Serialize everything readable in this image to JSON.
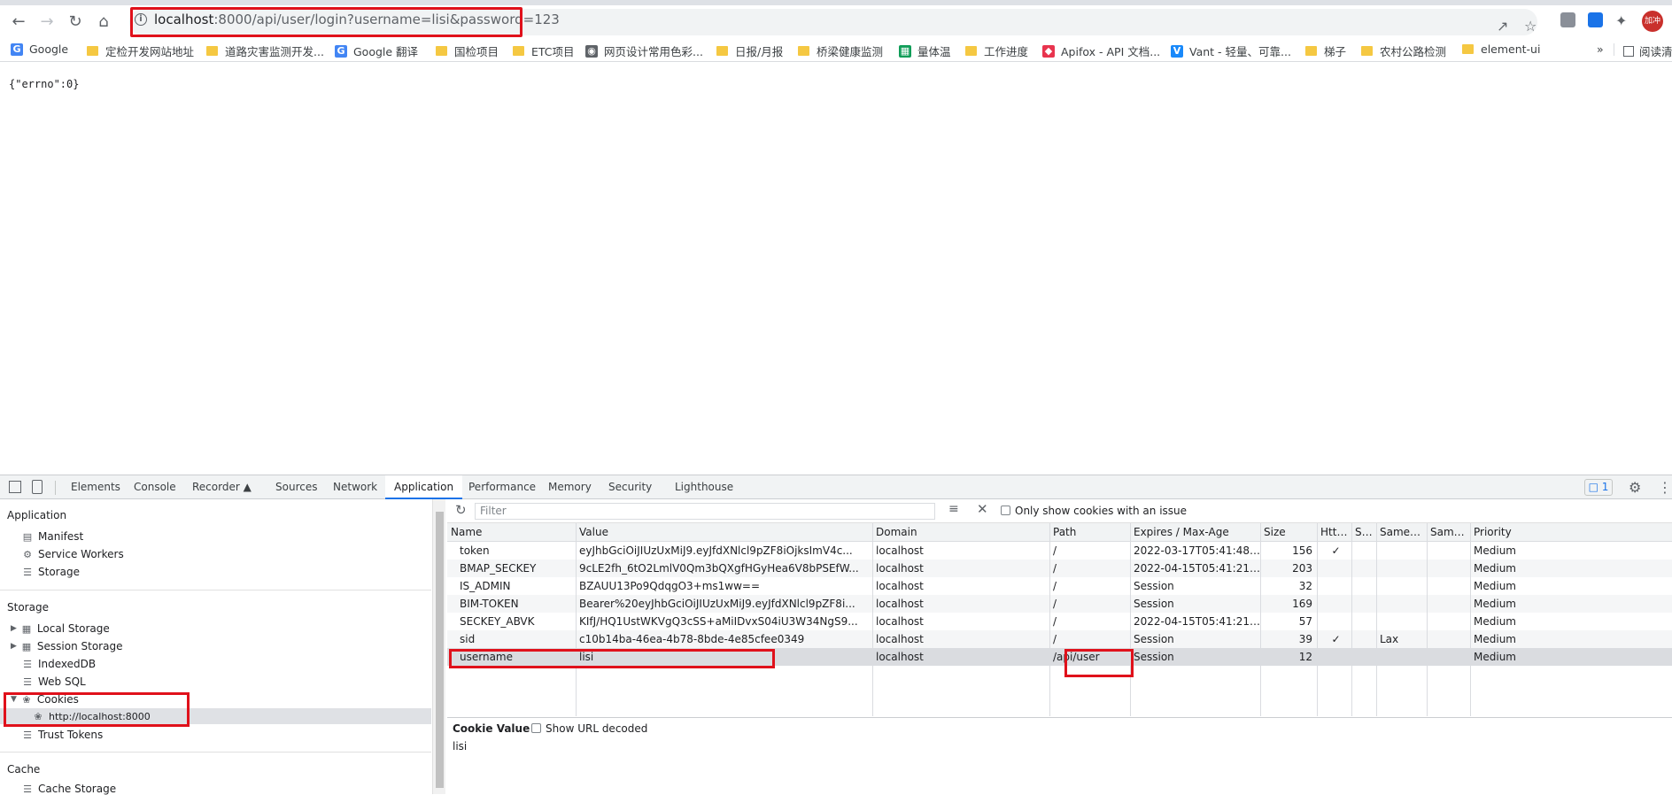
{
  "browser": {
    "url_host": "localhost",
    "url_rest": ":8000/api/user/login?username=lisi&password=123",
    "avatar_text": "加冲"
  },
  "bookmarks": [
    {
      "label": "Google",
      "type": "google"
    },
    {
      "label": "定检开发网站地址",
      "type": "folder"
    },
    {
      "label": "道路灾害监测开发...",
      "type": "folder"
    },
    {
      "label": "Google 翻译",
      "type": "translate"
    },
    {
      "label": "国检项目",
      "type": "folder"
    },
    {
      "label": "ETC项目",
      "type": "folder"
    },
    {
      "label": "网页设计常用色彩...",
      "type": "globe"
    },
    {
      "label": "日报/月报",
      "type": "folder"
    },
    {
      "label": "桥梁健康监测",
      "type": "folder"
    },
    {
      "label": "量体温",
      "type": "sheet"
    },
    {
      "label": "工作进度",
      "type": "folder"
    },
    {
      "label": "Apifox - API 文档...",
      "type": "apifox"
    },
    {
      "label": "Vant - 轻量、可靠...",
      "type": "vant"
    },
    {
      "label": "梯子",
      "type": "folder"
    },
    {
      "label": "农村公路检测",
      "type": "folder"
    },
    {
      "label": "element-ui",
      "type": "folder"
    }
  ],
  "bookmarks_more": "»",
  "reading_list": "阅读清",
  "page_body": "{\"errno\":0}",
  "devtools": {
    "tabs": [
      "Elements",
      "Console",
      "Recorder",
      "Sources",
      "Network",
      "Application",
      "Performance",
      "Memory",
      "Security",
      "Lighthouse"
    ],
    "active_tab": "Application",
    "issues_count": "1",
    "sidebar": {
      "application_header": "Application",
      "manifest": "Manifest",
      "service_workers": "Service Workers",
      "storage_item": "Storage",
      "storage_header": "Storage",
      "local_storage": "Local Storage",
      "session_storage": "Session Storage",
      "indexeddb": "IndexedDB",
      "web_sql": "Web SQL",
      "cookies": "Cookies",
      "cookie_origin": "http://localhost:8000",
      "trust_tokens": "Trust Tokens",
      "cache_header": "Cache",
      "cache_storage": "Cache Storage"
    },
    "cookies_toolbar": {
      "filter_placeholder": "Filter",
      "only_issue_label": "Only show cookies with an issue"
    },
    "columns": [
      "Name",
      "Value",
      "Domain",
      "Path",
      "Expires / Max-Age",
      "Size",
      "HttpO...",
      "Sec...",
      "SameSite",
      "SameParty",
      "Priority"
    ],
    "rows": [
      {
        "name": "token",
        "value": "eyJhbGciOiJIUzUxMiJ9.eyJfdXNlcl9pZF8iOjksImV4c...",
        "domain": "localhost",
        "path": "/",
        "expires": "2022-03-17T05:41:48.002Z",
        "size": "156",
        "httponly": "✓",
        "secure": "",
        "samesite": "",
        "sameparty": "",
        "priority": "Medium"
      },
      {
        "name": "BMAP_SECKEY",
        "value": "9cLE2fh_6tO2LmlV0Qm3bQXgfHGyHea6V8bPSEfW...",
        "domain": "localhost",
        "path": "/",
        "expires": "2022-04-15T05:41:21.000Z",
        "size": "203",
        "httponly": "",
        "secure": "",
        "samesite": "",
        "sameparty": "",
        "priority": "Medium"
      },
      {
        "name": "IS_ADMIN",
        "value": "BZAUU13Po9QdqgO3+ms1ww==",
        "domain": "localhost",
        "path": "/",
        "expires": "Session",
        "size": "32",
        "httponly": "",
        "secure": "",
        "samesite": "",
        "sameparty": "",
        "priority": "Medium"
      },
      {
        "name": "BIM-TOKEN",
        "value": "Bearer%20eyJhbGciOiJIUzUxMiJ9.eyJfdXNlcl9pZF8i...",
        "domain": "localhost",
        "path": "/",
        "expires": "Session",
        "size": "169",
        "httponly": "",
        "secure": "",
        "samesite": "",
        "sameparty": "",
        "priority": "Medium"
      },
      {
        "name": "SECKEY_ABVK",
        "value": "KIfJ/HQ1UstWKVgQ3cSS+aMiIDvxS04iU3W34NgS9...",
        "domain": "localhost",
        "path": "/",
        "expires": "2022-04-15T05:41:21.000Z",
        "size": "57",
        "httponly": "",
        "secure": "",
        "samesite": "",
        "sameparty": "",
        "priority": "Medium"
      },
      {
        "name": "sid",
        "value": "c10b14ba-46ea-4b78-8bde-4e85cfee0349",
        "domain": "localhost",
        "path": "/",
        "expires": "Session",
        "size": "39",
        "httponly": "✓",
        "secure": "",
        "samesite": "Lax",
        "sameparty": "",
        "priority": "Medium"
      },
      {
        "name": "username",
        "value": "lisi",
        "domain": "localhost",
        "path": "/api/user",
        "expires": "Session",
        "size": "12",
        "httponly": "",
        "secure": "",
        "samesite": "",
        "sameparty": "",
        "priority": "Medium"
      }
    ],
    "cookie_value": {
      "label": "Cookie Value",
      "decode_label": "Show URL decoded",
      "value": "lisi"
    }
  },
  "colors": {
    "highlight": "#e0111b",
    "accent": "#1a73e8"
  }
}
